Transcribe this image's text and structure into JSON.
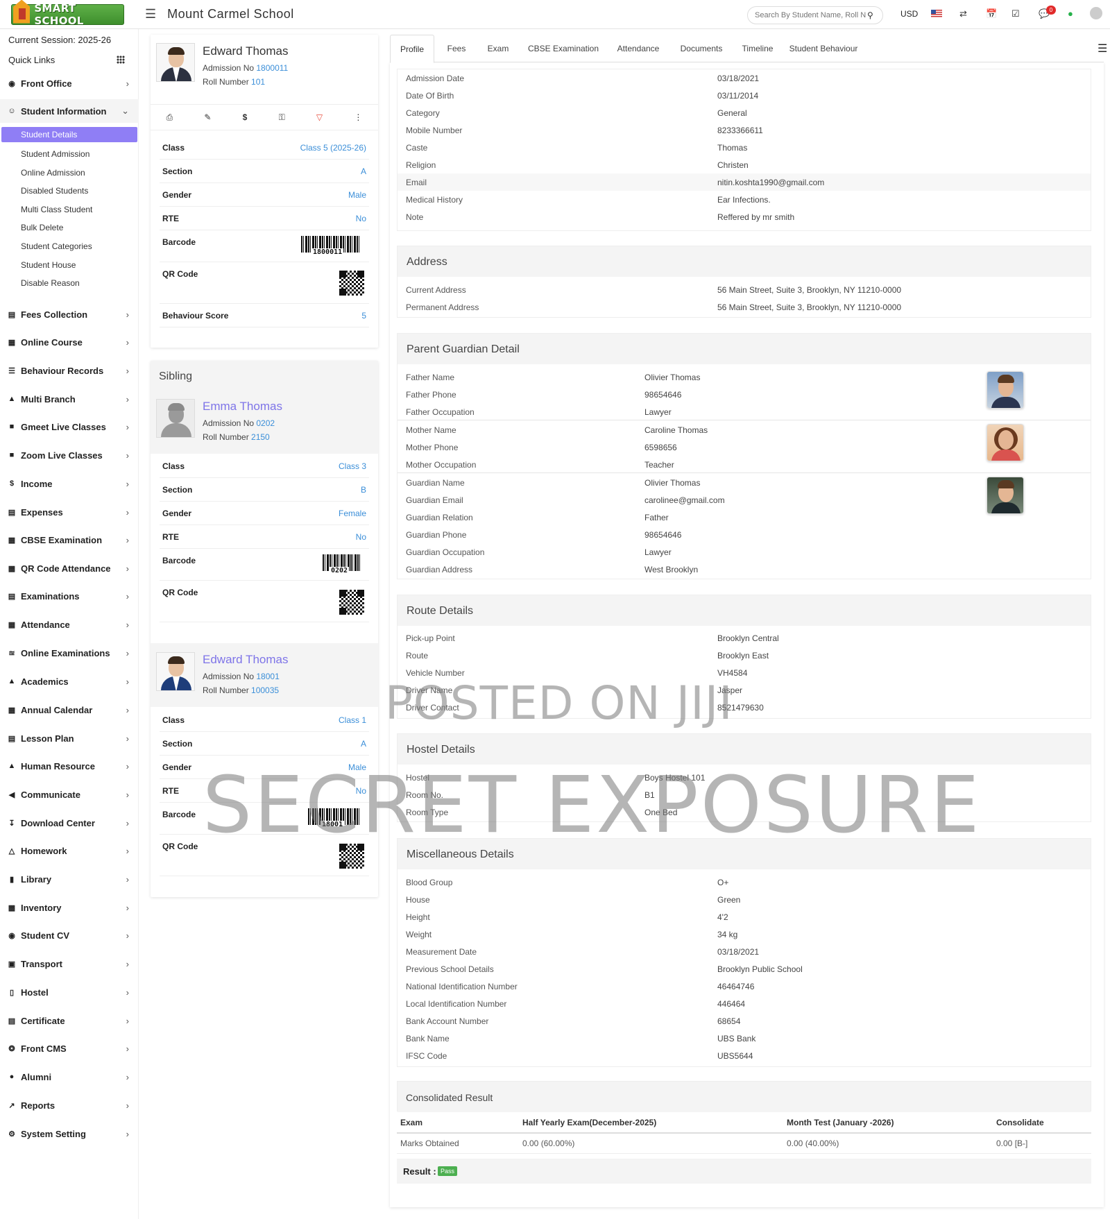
{
  "header": {
    "logo_text": "SMART SCHOOL",
    "school": "Mount Carmel School",
    "search_placeholder": "Search By Student Name, Roll Number, Enroll Number",
    "currency": "USD",
    "notif_count": "0"
  },
  "sidebar": {
    "session": "Current Session: 2025-26",
    "quick_links": "Quick Links",
    "student_info": "Student Information",
    "front_office": "Front Office",
    "subs": [
      "Student Details",
      "Student Admission",
      "Online Admission",
      "Disabled Students",
      "Multi Class Student",
      "Bulk Delete",
      "Student Categories",
      "Student House",
      "Disable Reason"
    ],
    "menu": [
      "Fees Collection",
      "Online Course",
      "Behaviour Records",
      "Multi Branch",
      "Gmeet Live Classes",
      "Zoom Live Classes",
      "Income",
      "Expenses",
      "CBSE Examination",
      "QR Code Attendance",
      "Examinations",
      "Attendance",
      "Online Examinations",
      "Academics",
      "Annual Calendar",
      "Lesson Plan",
      "Human Resource",
      "Communicate",
      "Download Center",
      "Homework",
      "Library",
      "Inventory",
      "Student CV",
      "Transport",
      "Hostel",
      "Certificate",
      "Front CMS",
      "Alumni",
      "Reports",
      "System Setting"
    ]
  },
  "profile": {
    "name": "Edward Thomas",
    "adm_label": "Admission No",
    "adm": "1800011",
    "roll_label": "Roll Number",
    "roll": "101",
    "rows": [
      {
        "k": "Class",
        "v": "Class 5 (2025-26)"
      },
      {
        "k": "Section",
        "v": "A"
      },
      {
        "k": "Gender",
        "v": "Male"
      },
      {
        "k": "RTE",
        "v": "No"
      }
    ],
    "barcode_label": "Barcode",
    "barcode": "1800011",
    "qr_label": "QR Code",
    "behaviour_label": "Behaviour Score",
    "behaviour": "5"
  },
  "sibling": {
    "title": "Sibling",
    "s1": {
      "name": "Emma Thomas",
      "adm_label": "Admission No",
      "adm": "0202",
      "roll_label": "Roll Number",
      "roll": "2150",
      "rows": [
        {
          "k": "Class",
          "v": "Class 3"
        },
        {
          "k": "Section",
          "v": "B"
        },
        {
          "k": "Gender",
          "v": "Female"
        },
        {
          "k": "RTE",
          "v": "No"
        }
      ],
      "barcode_label": "Barcode",
      "barcode": "0202",
      "qr_label": "QR Code"
    },
    "s2": {
      "name": "Edward Thomas",
      "adm_label": "Admission No",
      "adm": "18001",
      "roll_label": "Roll Number",
      "roll": "100035",
      "rows": [
        {
          "k": "Class",
          "v": "Class 1"
        },
        {
          "k": "Section",
          "v": "A"
        },
        {
          "k": "Gender",
          "v": "Male"
        },
        {
          "k": "RTE",
          "v": "No"
        }
      ],
      "barcode_label": "Barcode",
      "barcode": "18001",
      "qr_label": "QR Code"
    }
  },
  "tabs": [
    "Profile",
    "Fees",
    "Exam",
    "CBSE Examination",
    "Attendance",
    "Documents",
    "Timeline",
    "Student Behaviour"
  ],
  "basic": [
    {
      "k": "Admission Date",
      "v": "03/18/2021"
    },
    {
      "k": "Date Of Birth",
      "v": "03/11/2014"
    },
    {
      "k": "Category",
      "v": "General"
    },
    {
      "k": "Mobile Number",
      "v": "8233366611"
    },
    {
      "k": "Caste",
      "v": "Thomas"
    },
    {
      "k": "Religion",
      "v": "Christen"
    },
    {
      "k": "Email",
      "v": "nitin.koshta1990@gmail.com"
    },
    {
      "k": "Medical History",
      "v": "Ear Infections."
    },
    {
      "k": "Note",
      "v": "Reffered by mr smith"
    }
  ],
  "address": {
    "title": "Address",
    "rows": [
      {
        "k": "Current Address",
        "v": "56 Main Street, Suite 3, Brooklyn, NY 11210-0000"
      },
      {
        "k": "Permanent Address",
        "v": "56 Main Street, Suite 3, Brooklyn, NY 11210-0000"
      }
    ]
  },
  "parent": {
    "title": "Parent Guardian Detail",
    "rows": [
      {
        "k": "Father Name",
        "v": "Olivier Thomas"
      },
      {
        "k": "Father Phone",
        "v": "98654646"
      },
      {
        "k": "Father Occupation",
        "v": "Lawyer"
      },
      {
        "k": "Mother Name",
        "v": "Caroline Thomas"
      },
      {
        "k": "Mother Phone",
        "v": "6598656"
      },
      {
        "k": "Mother Occupation",
        "v": "Teacher"
      },
      {
        "k": "Guardian Name",
        "v": "Olivier Thomas"
      },
      {
        "k": "Guardian Email",
        "v": "carolinee@gmail.com"
      },
      {
        "k": "Guardian Relation",
        "v": "Father"
      },
      {
        "k": "Guardian Phone",
        "v": "98654646"
      },
      {
        "k": "Guardian Occupation",
        "v": "Lawyer"
      },
      {
        "k": "Guardian Address",
        "v": "West Brooklyn"
      }
    ]
  },
  "route": {
    "title": "Route Details",
    "rows": [
      {
        "k": "Pick-up Point",
        "v": "Brooklyn Central"
      },
      {
        "k": "Route",
        "v": "Brooklyn East"
      },
      {
        "k": "Vehicle Number",
        "v": "VH4584"
      },
      {
        "k": "Driver Name",
        "v": "Jasper"
      },
      {
        "k": "Driver Contact",
        "v": "8521479630"
      }
    ]
  },
  "hostel": {
    "title": "Hostel Details",
    "rows": [
      {
        "k": "Hostel",
        "v": "Boys Hostel 101"
      },
      {
        "k": "Room No.",
        "v": "B1"
      },
      {
        "k": "Room Type",
        "v": "One Bed"
      }
    ]
  },
  "misc": {
    "title": "Miscellaneous Details",
    "rows": [
      {
        "k": "Blood Group",
        "v": "O+"
      },
      {
        "k": "House",
        "v": "Green"
      },
      {
        "k": "Height",
        "v": "4'2"
      },
      {
        "k": "Weight",
        "v": "34 kg"
      },
      {
        "k": "Measurement Date",
        "v": "03/18/2021"
      },
      {
        "k": "Previous School Details",
        "v": "Brooklyn Public School"
      },
      {
        "k": "National Identification Number",
        "v": "46464746"
      },
      {
        "k": "Local Identification Number",
        "v": "446464"
      },
      {
        "k": "Bank Account Number",
        "v": "68654"
      },
      {
        "k": "Bank Name",
        "v": "UBS Bank"
      },
      {
        "k": "IFSC Code",
        "v": "UBS5644"
      }
    ]
  },
  "result": {
    "title": "Consolidated Result",
    "headers": [
      "Exam",
      "Half Yearly Exam(December-2025)",
      "Month Test (January -2026)",
      "Consolidate"
    ],
    "row": [
      "Marks Obtained",
      "0.00 (60.00%)",
      "0.00 (40.00%)",
      "0.00 [B-]"
    ],
    "label": "Result :",
    "status": "Pass"
  },
  "watermark": {
    "line1": "POSTED ON JIJI",
    "line2": "SECRET EXPOSURE"
  }
}
